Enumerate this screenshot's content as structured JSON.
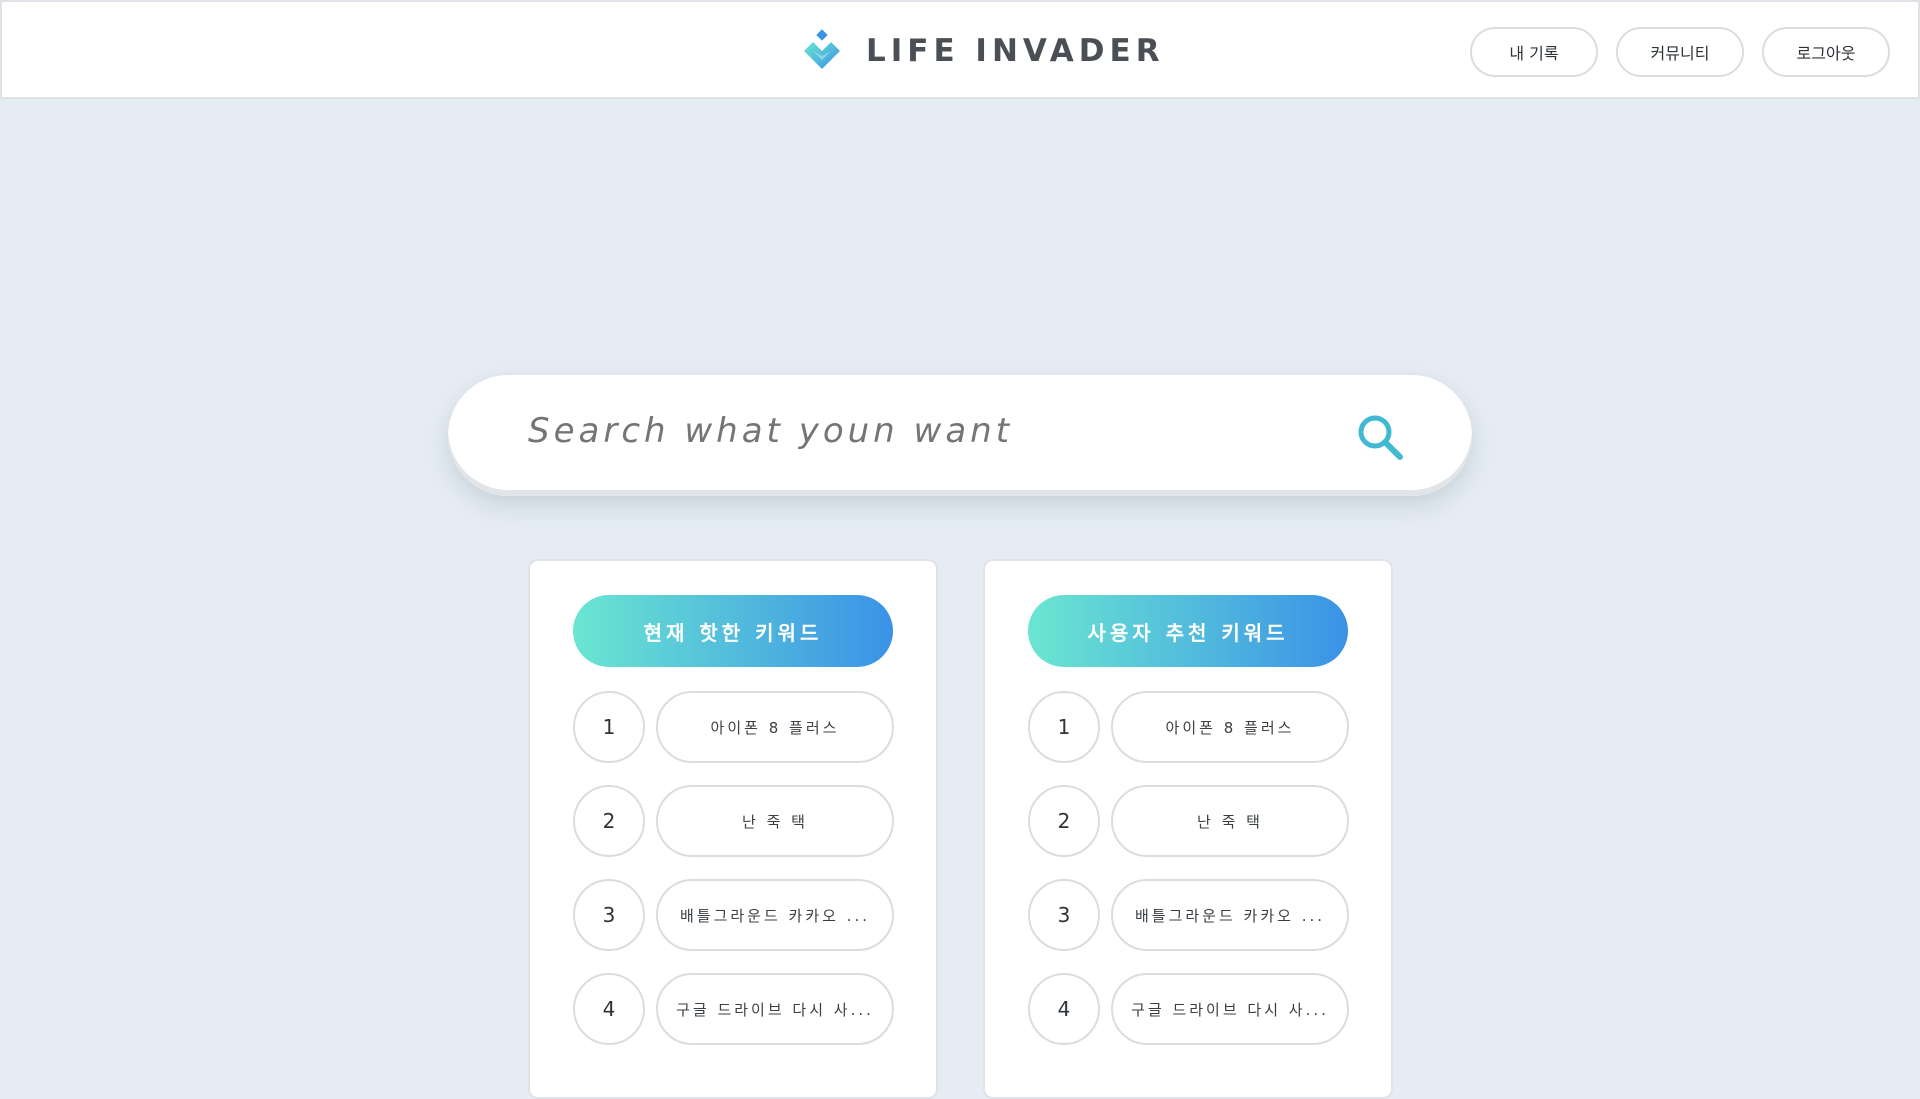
{
  "header": {
    "brand": "LIFE INVADER",
    "nav": [
      {
        "label": "내 기록"
      },
      {
        "label": "커뮤니티"
      },
      {
        "label": "로그아웃"
      }
    ]
  },
  "search": {
    "placeholder": "Search what youn want",
    "icon": "search-icon"
  },
  "panels": [
    {
      "title": "현재 핫한 키워드",
      "items": [
        {
          "rank": "1",
          "keyword": "아이폰 8 플러스"
        },
        {
          "rank": "2",
          "keyword": "난 죽 택"
        },
        {
          "rank": "3",
          "keyword": "배틀그라운드 카카오 ..."
        },
        {
          "rank": "4",
          "keyword": "구글 드라이브 다시 사..."
        }
      ]
    },
    {
      "title": "사용자 추천 키워드",
      "items": [
        {
          "rank": "1",
          "keyword": "아이폰 8 플러스"
        },
        {
          "rank": "2",
          "keyword": "난 죽 택"
        },
        {
          "rank": "3",
          "keyword": "배틀그라운드 카카오 ..."
        },
        {
          "rank": "4",
          "keyword": "구글 드라이브 다시 사..."
        }
      ]
    }
  ],
  "colors": {
    "background": "#e5ecf3",
    "gradient_start": "#6be6d1",
    "gradient_end": "#3a92e6",
    "accent": "#41b9d3"
  }
}
